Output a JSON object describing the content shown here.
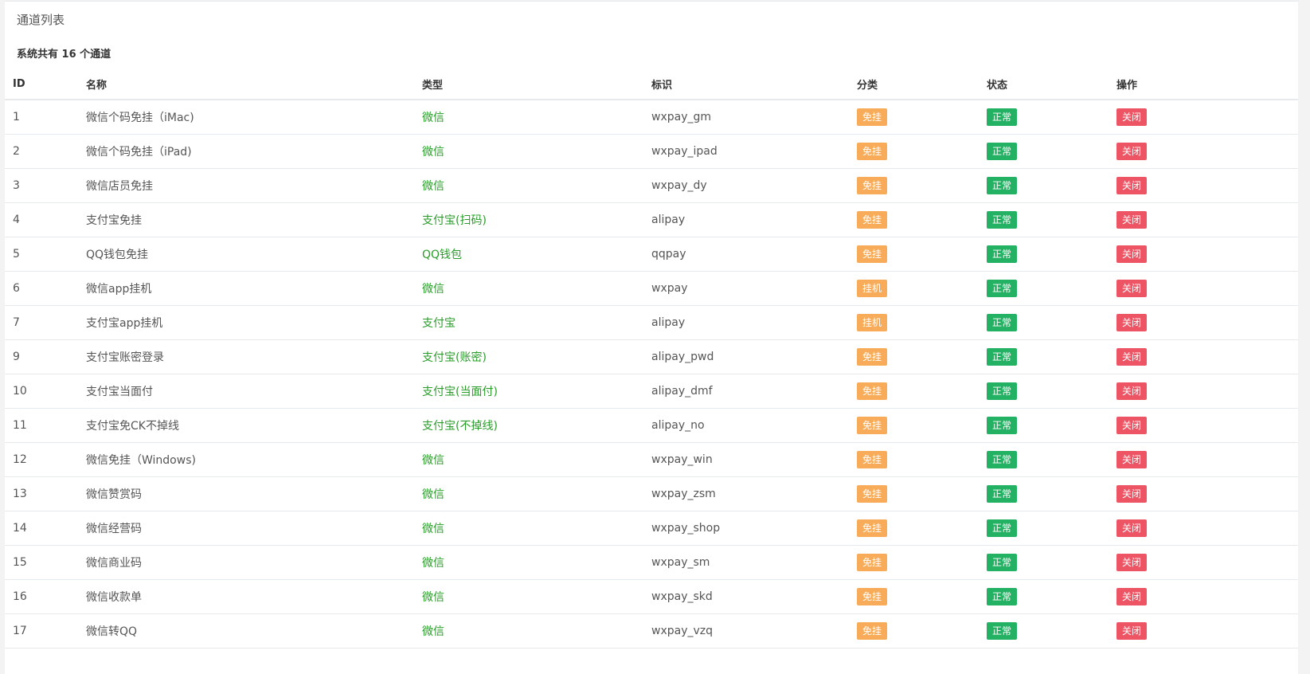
{
  "panel": {
    "title": "通道列表",
    "summary_prefix": "系统共有",
    "summary_count": "16",
    "summary_suffix": "个通道"
  },
  "table": {
    "headers": {
      "id": "ID",
      "name": "名称",
      "type": "类型",
      "code": "标识",
      "category": "分类",
      "status": "状态",
      "action": "操作"
    },
    "rows": [
      {
        "id": "1",
        "name": "微信个码免挂（iMac)",
        "type": "微信",
        "code": "wxpay_gm",
        "category": "免挂",
        "status": "正常",
        "action": "关闭"
      },
      {
        "id": "2",
        "name": "微信个码免挂（iPad)",
        "type": "微信",
        "code": "wxpay_ipad",
        "category": "免挂",
        "status": "正常",
        "action": "关闭"
      },
      {
        "id": "3",
        "name": "微信店员免挂",
        "type": "微信",
        "code": "wxpay_dy",
        "category": "免挂",
        "status": "正常",
        "action": "关闭"
      },
      {
        "id": "4",
        "name": "支付宝免挂",
        "type": "支付宝(扫码)",
        "code": "alipay",
        "category": "免挂",
        "status": "正常",
        "action": "关闭"
      },
      {
        "id": "5",
        "name": "QQ钱包免挂",
        "type": "QQ钱包",
        "code": "qqpay",
        "category": "免挂",
        "status": "正常",
        "action": "关闭"
      },
      {
        "id": "6",
        "name": "微信app挂机",
        "type": "微信",
        "code": "wxpay",
        "category": "挂机",
        "status": "正常",
        "action": "关闭"
      },
      {
        "id": "7",
        "name": "支付宝app挂机",
        "type": "支付宝",
        "code": "alipay",
        "category": "挂机",
        "status": "正常",
        "action": "关闭"
      },
      {
        "id": "9",
        "name": "支付宝账密登录",
        "type": "支付宝(账密)",
        "code": "alipay_pwd",
        "category": "免挂",
        "status": "正常",
        "action": "关闭"
      },
      {
        "id": "10",
        "name": "支付宝当面付",
        "type": "支付宝(当面付)",
        "code": "alipay_dmf",
        "category": "免挂",
        "status": "正常",
        "action": "关闭"
      },
      {
        "id": "11",
        "name": "支付宝免CK不掉线",
        "type": "支付宝(不掉线)",
        "code": "alipay_no",
        "category": "免挂",
        "status": "正常",
        "action": "关闭"
      },
      {
        "id": "12",
        "name": "微信免挂（Windows)",
        "type": "微信",
        "code": "wxpay_win",
        "category": "免挂",
        "status": "正常",
        "action": "关闭"
      },
      {
        "id": "13",
        "name": "微信赞赏码",
        "type": "微信",
        "code": "wxpay_zsm",
        "category": "免挂",
        "status": "正常",
        "action": "关闭"
      },
      {
        "id": "14",
        "name": "微信经营码",
        "type": "微信",
        "code": "wxpay_shop",
        "category": "免挂",
        "status": "正常",
        "action": "关闭"
      },
      {
        "id": "15",
        "name": "微信商业码",
        "type": "微信",
        "code": "wxpay_sm",
        "category": "免挂",
        "status": "正常",
        "action": "关闭"
      },
      {
        "id": "16",
        "name": "微信收款单",
        "type": "微信",
        "code": "wxpay_skd",
        "category": "免挂",
        "status": "正常",
        "action": "关闭"
      },
      {
        "id": "17",
        "name": "微信转QQ",
        "type": "微信",
        "code": "wxpay_vzq",
        "category": "免挂",
        "status": "正常",
        "action": "关闭"
      }
    ]
  },
  "colors": {
    "category_badge": "#f8ac59",
    "status_badge": "#23b163",
    "action_badge": "#ed5565",
    "type_text": "#2a9c2a"
  }
}
